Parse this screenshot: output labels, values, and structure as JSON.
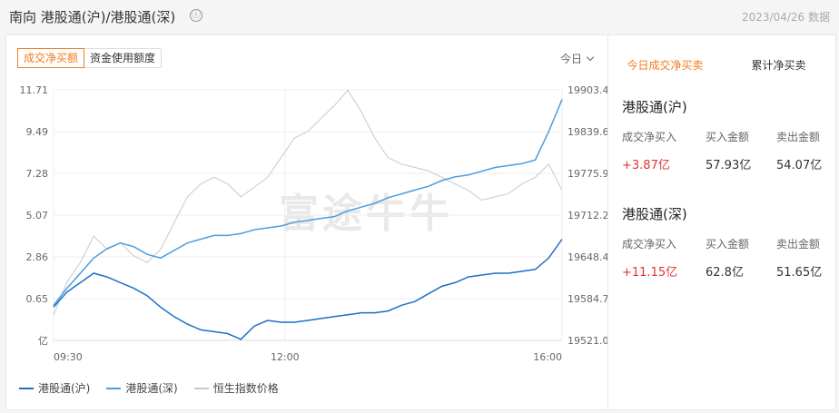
{
  "header": {
    "title": "南向 港股通(沪)/港股通(深)",
    "info_icon": "ⓘ",
    "date": "2023/04/26 数据"
  },
  "chart_tabs": [
    "成交净买额",
    "资金使用额度"
  ],
  "period_select": "今日",
  "watermark": "富途牛牛",
  "side": {
    "tabs": [
      "今日成交净买卖",
      "累计净买卖"
    ],
    "blocks": [
      {
        "title": "港股通(沪)",
        "labels": [
          "成交净买入",
          "买入金额",
          "卖出金额"
        ],
        "values": [
          "+3.87亿",
          "57.93亿",
          "54.07亿"
        ]
      },
      {
        "title": "港股通(深)",
        "labels": [
          "成交净买入",
          "买入金额",
          "卖出金额"
        ],
        "values": [
          "+11.15亿",
          "62.8亿",
          "51.65亿"
        ]
      }
    ]
  },
  "colors": {
    "sh": "#1f6fc5",
    "sz": "#4a9de0",
    "hsi": "#c8c8c8",
    "accent": "#f07c20",
    "positive": "#e93030"
  },
  "chart_data": {
    "type": "line",
    "x_ticks": [
      "09:30",
      "12:00",
      "16:00"
    ],
    "y_left_unit": "亿",
    "y_left_ticks": [
      "11.71",
      "9.49",
      "7.28",
      "5.07",
      "2.86",
      "0.65"
    ],
    "y_left_range": [
      -1.56,
      11.71
    ],
    "y_right_ticks": [
      "19903.4",
      "19839.6",
      "19775.9",
      "19712.2",
      "19648.4",
      "19584.7",
      "19521.0"
    ],
    "y_right_range": [
      19521.0,
      19903.4
    ],
    "series": [
      {
        "name": "港股通(沪)",
        "axis": "left",
        "values": [
          0.2,
          1.0,
          1.5,
          2.0,
          1.8,
          1.5,
          1.2,
          0.8,
          0.2,
          -0.3,
          -0.7,
          -1.0,
          -1.1,
          -1.2,
          -1.5,
          -0.8,
          -0.5,
          -0.6,
          -0.6,
          -0.5,
          -0.4,
          -0.3,
          -0.2,
          -0.1,
          -0.1,
          0.0,
          0.3,
          0.5,
          0.9,
          1.3,
          1.5,
          1.8,
          1.9,
          2.0,
          2.0,
          2.1,
          2.2,
          2.8,
          3.8
        ]
      },
      {
        "name": "港股通(深)",
        "axis": "left",
        "values": [
          0.3,
          1.2,
          2.0,
          2.8,
          3.3,
          3.6,
          3.4,
          3.0,
          2.8,
          3.2,
          3.6,
          3.8,
          4.0,
          4.0,
          4.1,
          4.3,
          4.4,
          4.5,
          4.7,
          4.8,
          4.9,
          5.0,
          5.3,
          5.5,
          5.7,
          6.0,
          6.2,
          6.4,
          6.6,
          6.9,
          7.1,
          7.2,
          7.4,
          7.6,
          7.7,
          7.8,
          8.0,
          9.5,
          11.2
        ]
      },
      {
        "name": "恒生指数价格",
        "axis": "right",
        "values": [
          19560,
          19610,
          19640,
          19680,
          19660,
          19670,
          19650,
          19640,
          19660,
          19700,
          19740,
          19760,
          19770,
          19760,
          19740,
          19755,
          19770,
          19800,
          19830,
          19840,
          19860,
          19880,
          19903,
          19870,
          19830,
          19800,
          19790,
          19785,
          19780,
          19770,
          19760,
          19750,
          19735,
          19740,
          19745,
          19760,
          19770,
          19790,
          19750
        ]
      }
    ]
  }
}
